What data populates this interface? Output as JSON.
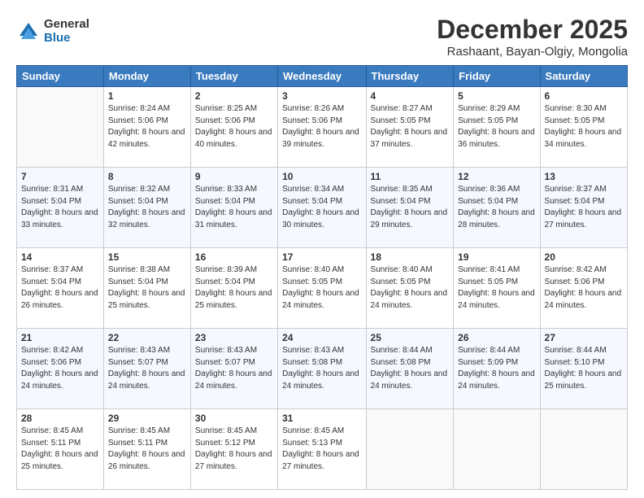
{
  "logo": {
    "general": "General",
    "blue": "Blue"
  },
  "header": {
    "month": "December 2025",
    "location": "Rashaant, Bayan-Olgiy, Mongolia"
  },
  "weekdays": [
    "Sunday",
    "Monday",
    "Tuesday",
    "Wednesday",
    "Thursday",
    "Friday",
    "Saturday"
  ],
  "weeks": [
    [
      {
        "day": "",
        "detail": ""
      },
      {
        "day": "1",
        "detail": "Sunrise: 8:24 AM\nSunset: 5:06 PM\nDaylight: 8 hours\nand 42 minutes."
      },
      {
        "day": "2",
        "detail": "Sunrise: 8:25 AM\nSunset: 5:06 PM\nDaylight: 8 hours\nand 40 minutes."
      },
      {
        "day": "3",
        "detail": "Sunrise: 8:26 AM\nSunset: 5:06 PM\nDaylight: 8 hours\nand 39 minutes."
      },
      {
        "day": "4",
        "detail": "Sunrise: 8:27 AM\nSunset: 5:05 PM\nDaylight: 8 hours\nand 37 minutes."
      },
      {
        "day": "5",
        "detail": "Sunrise: 8:29 AM\nSunset: 5:05 PM\nDaylight: 8 hours\nand 36 minutes."
      },
      {
        "day": "6",
        "detail": "Sunrise: 8:30 AM\nSunset: 5:05 PM\nDaylight: 8 hours\nand 34 minutes."
      }
    ],
    [
      {
        "day": "7",
        "detail": "Sunrise: 8:31 AM\nSunset: 5:04 PM\nDaylight: 8 hours\nand 33 minutes."
      },
      {
        "day": "8",
        "detail": "Sunrise: 8:32 AM\nSunset: 5:04 PM\nDaylight: 8 hours\nand 32 minutes."
      },
      {
        "day": "9",
        "detail": "Sunrise: 8:33 AM\nSunset: 5:04 PM\nDaylight: 8 hours\nand 31 minutes."
      },
      {
        "day": "10",
        "detail": "Sunrise: 8:34 AM\nSunset: 5:04 PM\nDaylight: 8 hours\nand 30 minutes."
      },
      {
        "day": "11",
        "detail": "Sunrise: 8:35 AM\nSunset: 5:04 PM\nDaylight: 8 hours\nand 29 minutes."
      },
      {
        "day": "12",
        "detail": "Sunrise: 8:36 AM\nSunset: 5:04 PM\nDaylight: 8 hours\nand 28 minutes."
      },
      {
        "day": "13",
        "detail": "Sunrise: 8:37 AM\nSunset: 5:04 PM\nDaylight: 8 hours\nand 27 minutes."
      }
    ],
    [
      {
        "day": "14",
        "detail": "Sunrise: 8:37 AM\nSunset: 5:04 PM\nDaylight: 8 hours\nand 26 minutes."
      },
      {
        "day": "15",
        "detail": "Sunrise: 8:38 AM\nSunset: 5:04 PM\nDaylight: 8 hours\nand 25 minutes."
      },
      {
        "day": "16",
        "detail": "Sunrise: 8:39 AM\nSunset: 5:04 PM\nDaylight: 8 hours\nand 25 minutes."
      },
      {
        "day": "17",
        "detail": "Sunrise: 8:40 AM\nSunset: 5:05 PM\nDaylight: 8 hours\nand 24 minutes."
      },
      {
        "day": "18",
        "detail": "Sunrise: 8:40 AM\nSunset: 5:05 PM\nDaylight: 8 hours\nand 24 minutes."
      },
      {
        "day": "19",
        "detail": "Sunrise: 8:41 AM\nSunset: 5:05 PM\nDaylight: 8 hours\nand 24 minutes."
      },
      {
        "day": "20",
        "detail": "Sunrise: 8:42 AM\nSunset: 5:06 PM\nDaylight: 8 hours\nand 24 minutes."
      }
    ],
    [
      {
        "day": "21",
        "detail": "Sunrise: 8:42 AM\nSunset: 5:06 PM\nDaylight: 8 hours\nand 24 minutes."
      },
      {
        "day": "22",
        "detail": "Sunrise: 8:43 AM\nSunset: 5:07 PM\nDaylight: 8 hours\nand 24 minutes."
      },
      {
        "day": "23",
        "detail": "Sunrise: 8:43 AM\nSunset: 5:07 PM\nDaylight: 8 hours\nand 24 minutes."
      },
      {
        "day": "24",
        "detail": "Sunrise: 8:43 AM\nSunset: 5:08 PM\nDaylight: 8 hours\nand 24 minutes."
      },
      {
        "day": "25",
        "detail": "Sunrise: 8:44 AM\nSunset: 5:08 PM\nDaylight: 8 hours\nand 24 minutes."
      },
      {
        "day": "26",
        "detail": "Sunrise: 8:44 AM\nSunset: 5:09 PM\nDaylight: 8 hours\nand 24 minutes."
      },
      {
        "day": "27",
        "detail": "Sunrise: 8:44 AM\nSunset: 5:10 PM\nDaylight: 8 hours\nand 25 minutes."
      }
    ],
    [
      {
        "day": "28",
        "detail": "Sunrise: 8:45 AM\nSunset: 5:11 PM\nDaylight: 8 hours\nand 25 minutes."
      },
      {
        "day": "29",
        "detail": "Sunrise: 8:45 AM\nSunset: 5:11 PM\nDaylight: 8 hours\nand 26 minutes."
      },
      {
        "day": "30",
        "detail": "Sunrise: 8:45 AM\nSunset: 5:12 PM\nDaylight: 8 hours\nand 27 minutes."
      },
      {
        "day": "31",
        "detail": "Sunrise: 8:45 AM\nSunset: 5:13 PM\nDaylight: 8 hours\nand 27 minutes."
      },
      {
        "day": "",
        "detail": ""
      },
      {
        "day": "",
        "detail": ""
      },
      {
        "day": "",
        "detail": ""
      }
    ]
  ]
}
